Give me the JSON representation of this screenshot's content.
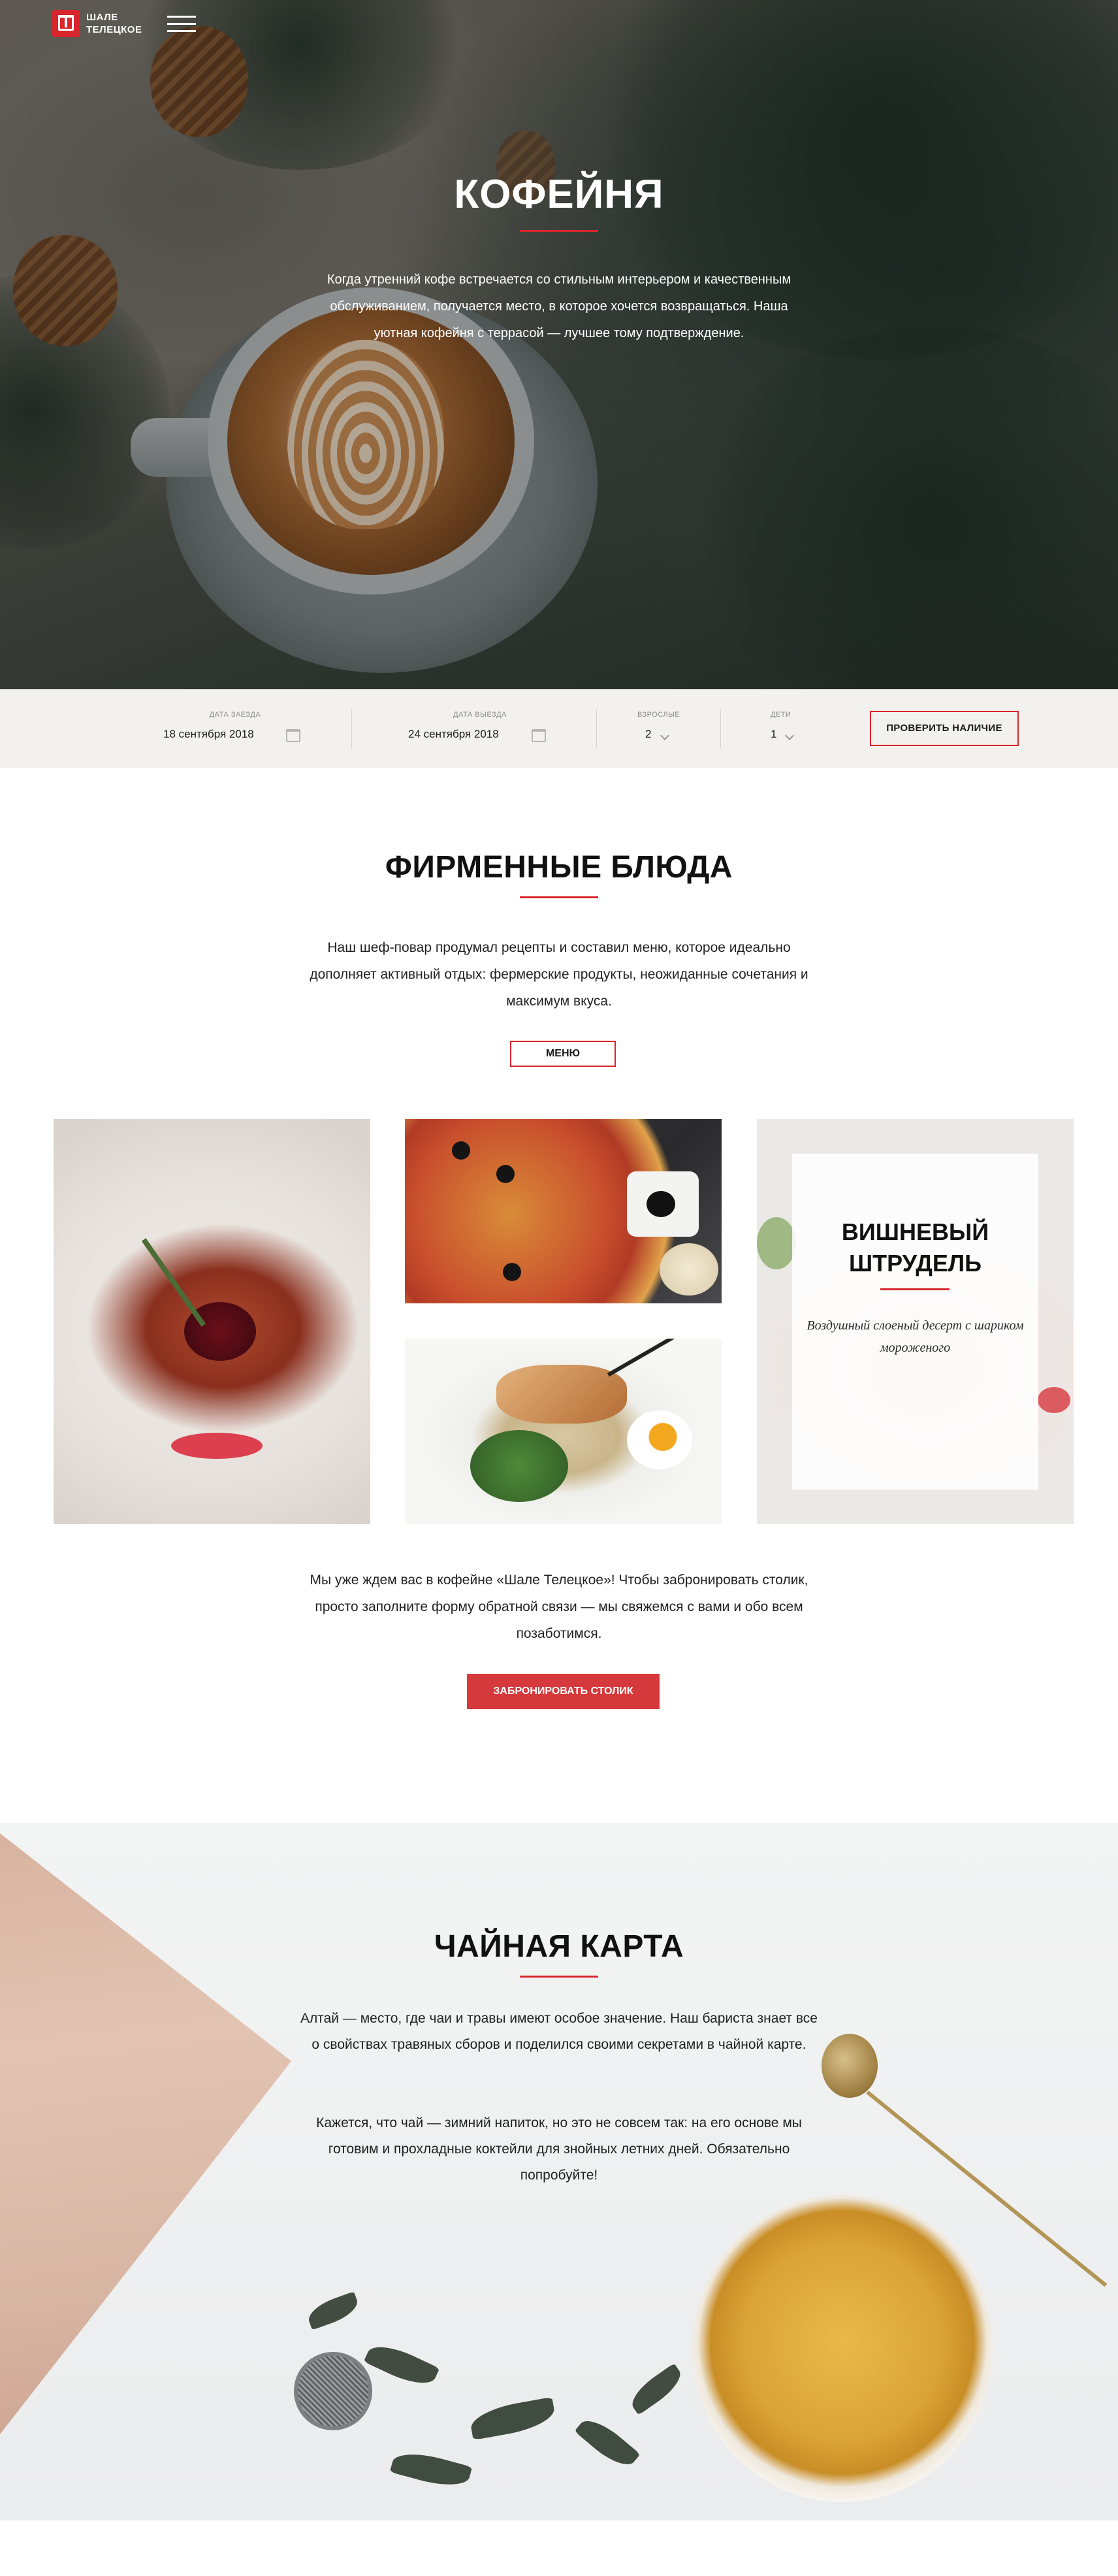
{
  "header": {
    "logo_text_line1": "ШАЛЕ",
    "logo_text_line2": "ТЕЛЕЦКОЕ",
    "menu_icon": "hamburger-icon"
  },
  "hero": {
    "title": "КОФЕЙНЯ",
    "text": "Когда утренний кофе встречается со стильным интерьером и качественным обслуживанием, получается место, в которое хочется возвращаться. Наша уютная кофейня с террасой — лучшее тому подтверждение."
  },
  "booking": {
    "checkin_label": "ДАТА ЗАЕЗДА",
    "checkin_value": "18 сентября 2018",
    "checkout_label": "ДАТА ВЫЕЗДА",
    "checkout_value": "24 сентября 2018",
    "adults_label": "ВЗРОСЛЫЕ",
    "adults_value": "2",
    "children_label": "ДЕТИ",
    "children_value": "1",
    "check_button": "ПРОВЕРИТЬ НАЛИЧИЕ",
    "calendar_icon": "calendar-icon",
    "dropdown_icon": "chevron-down-icon"
  },
  "dishes": {
    "title": "ФИРМЕННЫЕ БЛЮДА",
    "text": "Наш шеф-повар продумал рецепты и составил меню, которое идеально дополняет активный отдых: фермерские продукты, неожиданные сочетания и максимум вкуса.",
    "menu_button": "МЕНЮ",
    "strudel_title": "ВИШНЕВЫЙ ШТРУДЕЛЬ",
    "strudel_text": "Воздушный слоеный десерт с шариком мороженого",
    "reserve_text": "Мы уже ждем вас в кофейне «Шале Телецкое»! Чтобы забронировать столик, просто заполните форму обратной связи — мы свяжемся с вами и обо всем позаботимся.",
    "reserve_button": "ЗАБРОНИРОВАТЬ СТОЛИК"
  },
  "tea": {
    "title": "ЧАЙНАЯ КАРТА",
    "text1": "Алтай — место, где чаи и травы имеют особое значение. Наш бариста знает все о свойствах травяных сборов и поделился своими секретами в чайной карте.",
    "text2": "Кажется, что чай — зимний напиток, но это не совсем так: на его основе мы готовим и прохладные коктейли для знойных летних дней. Обязательно попробуйте!"
  },
  "colors": {
    "accent": "#d8262c",
    "button_red": "#d6393c",
    "booking_bg": "#f3f1ee"
  }
}
